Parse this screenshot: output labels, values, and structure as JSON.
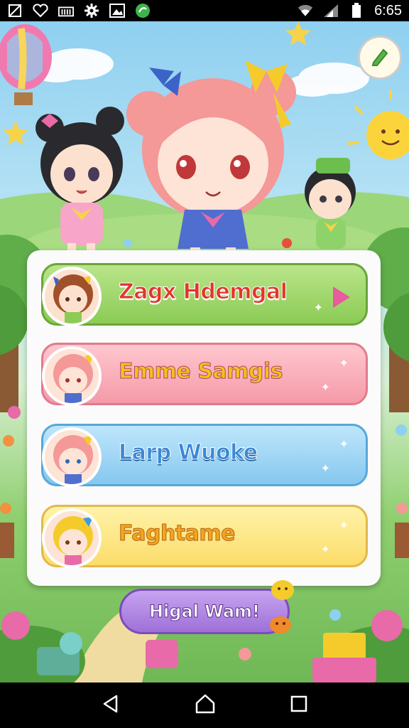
{
  "status_bar": {
    "time": "6:65",
    "left_icons": [
      "no-sim-icon",
      "heart-icon",
      "library-icon",
      "gear-icon",
      "image-icon",
      "app-badge-icon"
    ],
    "right_icons": [
      "wifi-icon",
      "signal-icon",
      "battery-icon"
    ]
  },
  "menu": {
    "items": [
      {
        "label": "Zagx Hdemgal",
        "color": "green",
        "avatar": "brown-hair-girl"
      },
      {
        "label": "Emme Samgis",
        "color": "pink",
        "avatar": "pink-hair-girl"
      },
      {
        "label": "Larp Wuoke",
        "color": "blue",
        "avatar": "pink-hair-blue-eyes-girl"
      },
      {
        "label": "Faghtame",
        "color": "yellow",
        "avatar": "blonde-hair-girl"
      }
    ]
  },
  "bottom_button": {
    "label": "Higal Wam!"
  },
  "nav_bar": {
    "icons": [
      "back-icon",
      "home-icon",
      "recents-icon"
    ]
  },
  "colors": {
    "green": "#8ccb55",
    "pink": "#f59aa8",
    "blue": "#85c8ef",
    "yellow": "#fbdc6a",
    "purple": "#9e70d8"
  }
}
